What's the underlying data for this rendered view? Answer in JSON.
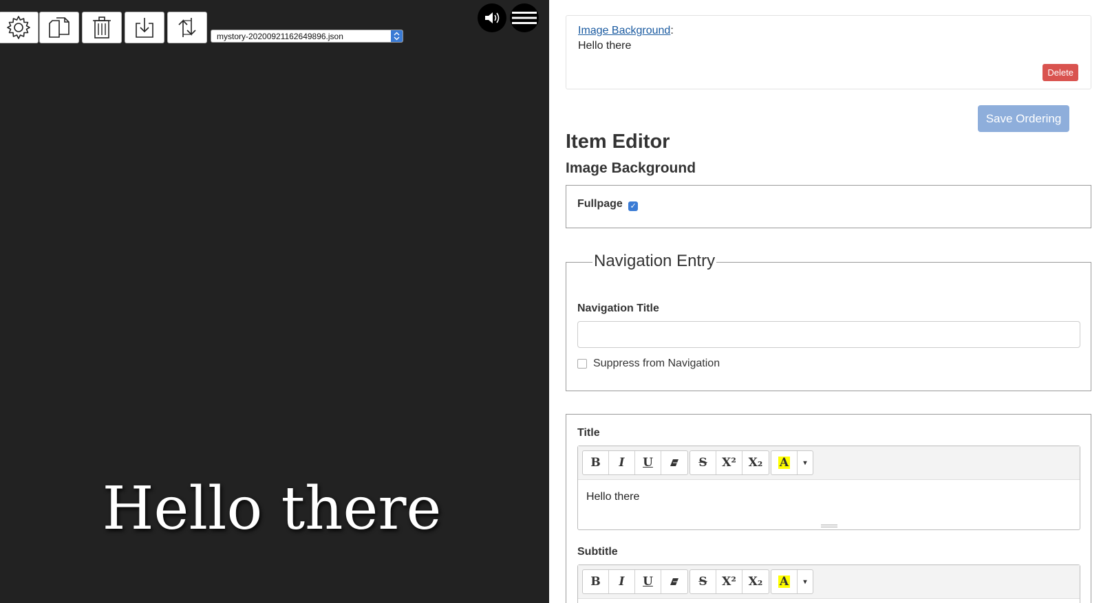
{
  "toolbar": {
    "buttons": [
      {
        "name": "settings",
        "icon": "gear-icon"
      },
      {
        "name": "copy",
        "icon": "copy-icon"
      },
      {
        "name": "delete",
        "icon": "trash-icon"
      },
      {
        "name": "download",
        "icon": "download-icon"
      },
      {
        "name": "sync",
        "icon": "sync-icon"
      }
    ],
    "file_select_value": "mystory-20200921162649896.json",
    "audio_icon": "speaker-icon",
    "menu_icon": "hamburger-menu-icon"
  },
  "preview": {
    "hero_text": "Hello there",
    "background": "#222222"
  },
  "entry_card": {
    "link_label": "Image Background",
    "separator": ":",
    "text": "Hello there",
    "delete_label": "Delete"
  },
  "save_ordering_label": "Save Ordering",
  "item_editor": {
    "heading": "Item Editor",
    "type_heading": "Image Background",
    "fullpage_label": "Fullpage",
    "fullpage_checked": true,
    "navigation": {
      "legend": "Navigation Entry",
      "title_label": "Navigation Title",
      "title_value": "",
      "suppress_label": "Suppress from Navigation",
      "suppress_checked": false
    },
    "title_label": "Title",
    "title_value": "Hello there",
    "subtitle_label": "Subtitle",
    "subtitle_value": "",
    "rte_toolbar": {
      "bold": "B",
      "italic": "I",
      "underline": "U",
      "eraser_icon": "eraser-icon",
      "strike": "S",
      "superscript": "X²",
      "subscript": "X₂",
      "highlight": "A",
      "dropdown": "▾"
    }
  },
  "colors": {
    "delete": "#d9534f",
    "save": "#8eaedb",
    "link": "#1a5aa0",
    "checkbox": "#3a7bd5"
  }
}
